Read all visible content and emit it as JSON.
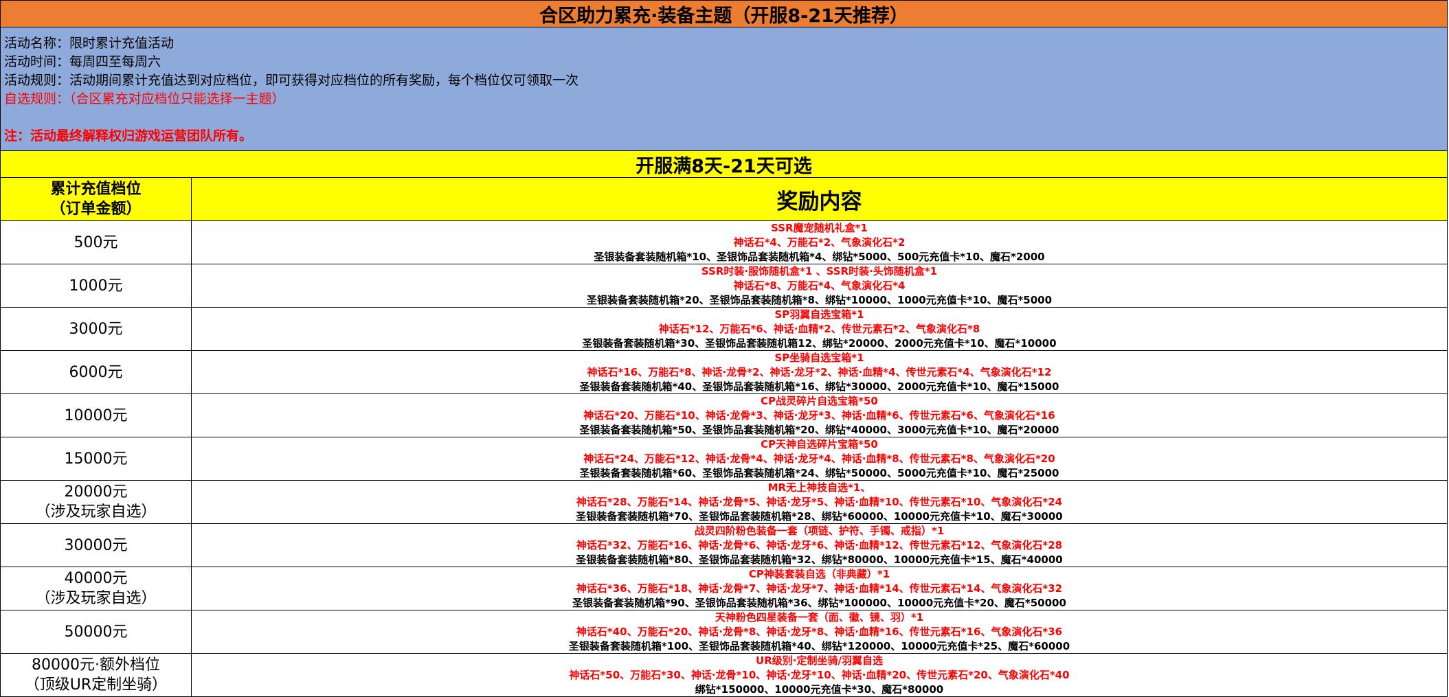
{
  "title": "合区助力累充·装备主题（开服8-21天推荐）",
  "info": {
    "name": "活动名称：限时累计充值活动",
    "time": "活动时间：每周四至每周六",
    "rule": "活动规则：活动期间累计充值达到对应档位，即可获得对应档位的所有奖励，每个档位仅可领取一次",
    "choice_rule": "自选规则：（合区累充对应档位只能选择一主题）",
    "note": "注：活动最终解释权归游戏运营团队所有。"
  },
  "section_title": "开服满8天-21天可选",
  "header": {
    "tier_line1": "累计充值档位",
    "tier_line2": "（订单金额）",
    "reward": "奖励内容"
  },
  "colors": {
    "title_bg": "#ed7d31",
    "info_bg": "#8eaadb",
    "section_bg": "#ffff00",
    "highlight_text": "#ff0000"
  },
  "tiers": [
    {
      "amount": "500元",
      "note": "",
      "rewards": [
        "SSR魔宠随机礼盒*1",
        "神话石*4、万能石*2、气象演化石*2",
        "圣银装备套装随机箱*10、圣银饰品套装随机箱*4、绑钻*5000、500元充值卡*10、魔石*2000"
      ]
    },
    {
      "amount": "1000元",
      "note": "",
      "rewards": [
        "SSR时装·服饰随机盒*1 、SSR时装·头饰随机盒*1",
        "神话石*8、万能石*4、气象演化石*4",
        "圣银装备套装随机箱*20、圣银饰品套装随机箱*8、绑钻*10000、1000元充值卡*10、魔石*5000"
      ]
    },
    {
      "amount": "3000元",
      "note": "",
      "rewards": [
        "SP羽翼自选宝箱*1",
        "神话石*12、万能石*6、神话·血精*2、传世元素石*2、气象演化石*8",
        "圣银装备套装随机箱*30、圣银饰品套装随机箱12、绑钻*20000、2000元充值卡*10、魔石*10000"
      ]
    },
    {
      "amount": "6000元",
      "note": "",
      "rewards": [
        "SP坐骑自选宝箱*1",
        "神话石*16、万能石*8、神话·龙骨*2、神话·龙牙*2、神话·血精*4、传世元素石*4、气象演化石*12",
        "圣银装备套装随机箱*40、圣银饰品套装随机箱*16、绑钻*30000、2000元充值卡*10、魔石*15000"
      ]
    },
    {
      "amount": "10000元",
      "note": "",
      "rewards": [
        "CP战灵碎片自选宝箱*50",
        "神话石*20、万能石*10、神话·龙骨*3、神话·龙牙*3、神话·血精*6、传世元素石*6、气象演化石*16",
        "圣银装备套装随机箱*50、圣银饰品套装随机箱*20、绑钻*40000、3000元充值卡*10、魔石*20000"
      ]
    },
    {
      "amount": "15000元",
      "note": "",
      "rewards": [
        "CP天神自选碎片宝箱*50",
        "神话石*24、万能石*12、神话·龙骨*4、神话·龙牙*4、神话·血精*8、传世元素石*8、气象演化石*20",
        "圣银装备套装随机箱*60、圣银饰品套装随机箱*24、绑钻*50000、5000元充值卡*10、魔石*25000"
      ]
    },
    {
      "amount": "20000元",
      "note": "（涉及玩家自选）",
      "rewards": [
        "MR无上神技自选*1、",
        "神话石*28、万能石*14、神话·龙骨*5、神话·龙牙*5、神话·血精*10、传世元素石*10、气象演化石*24",
        "圣银装备套装随机箱*70、圣银饰品套装随机箱*28、绑钻*60000、10000元充值卡*10、魔石*30000"
      ]
    },
    {
      "amount": "30000元",
      "note": "",
      "rewards": [
        "战灵四阶粉色装备一套（项链、护符、手镯、戒指）*1",
        "神话石*32、万能石*16、神话·龙骨*6、神话·龙牙*6、神话·血精*12、传世元素石*12、气象演化石*28",
        "圣银装备套装随机箱*80、圣银饰品套装随机箱*32、绑钻*80000、10000元充值卡*15、魔石*40000"
      ]
    },
    {
      "amount": "40000元",
      "note": "（涉及玩家自选）",
      "rewards": [
        "CP神装套装自选（非典藏）*1",
        "神话石*36、万能石*18、神话·龙骨*7、神话·龙牙*7、神话·血精*14、传世元素石*14、气象演化石*32",
        "圣银装备套装随机箱*90、圣银饰品套装随机箱*36、绑钻*100000、10000元充值卡*20、魔石*50000"
      ]
    },
    {
      "amount": "50000元",
      "note": "",
      "rewards": [
        "天神粉色四星装备一套（面、徽、镜、羽）*1",
        "神话石*40、万能石*20、神话·龙骨*8、神话·龙牙*8、神话·血精*16、传世元素石*16、气象演化石*36",
        "圣银装备套装随机箱*100、圣银饰品套装随机箱*40、绑钻*120000、10000元充值卡*25、魔石*60000"
      ]
    },
    {
      "amount": "80000元·额外档位",
      "note": "（顶级UR定制坐骑）",
      "rewards": [
        "UR级别·定制坐骑/羽翼自选",
        "神话石*50、万能石*30、神话·龙骨*10、神话·龙牙*10、神话·血精*20、传世元素石*20、气象演化石*40",
        "绑钻*150000、10000元充值卡*30、魔石*80000"
      ]
    }
  ]
}
